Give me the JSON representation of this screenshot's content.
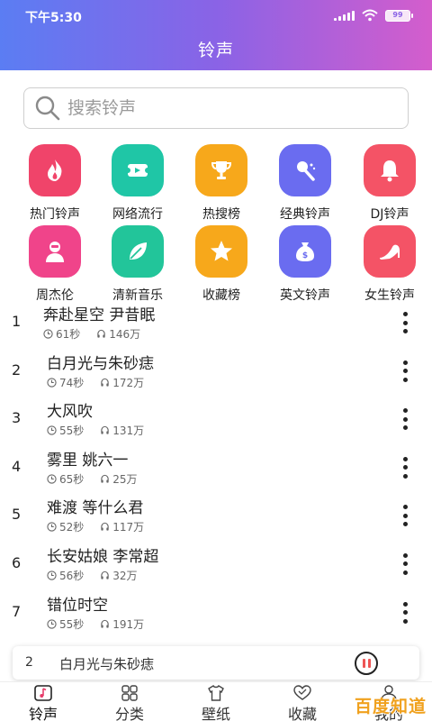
{
  "status_bar": {
    "time": "下午5:30",
    "battery": "99"
  },
  "header": {
    "title": "铃声"
  },
  "search": {
    "placeholder": "搜索铃声"
  },
  "categories": [
    {
      "label": "热门铃声",
      "icon": "flame-icon",
      "color": "#f0446a"
    },
    {
      "label": "网络流行",
      "icon": "ticket-icon",
      "color": "#1fc6a6"
    },
    {
      "label": "热搜榜",
      "icon": "trophy-icon",
      "color": "#f7a81b"
    },
    {
      "label": "经典铃声",
      "icon": "microphone-icon",
      "color": "#6a6cf0"
    },
    {
      "label": "DJ铃声",
      "icon": "bell-icon",
      "color": "#f45366"
    },
    {
      "label": "周杰伦",
      "icon": "singer-icon",
      "color": "#f0448a"
    },
    {
      "label": "清新音乐",
      "icon": "leaf-icon",
      "color": "#22c59a"
    },
    {
      "label": "收藏榜",
      "icon": "star-icon",
      "color": "#f7a81b"
    },
    {
      "label": "英文铃声",
      "icon": "money-bag-icon",
      "color": "#6a6cf0"
    },
    {
      "label": "女生铃声",
      "icon": "high-heel-icon",
      "color": "#f45366"
    }
  ],
  "songs": [
    {
      "rank": "1",
      "title": "奔赴星空 尹昔眠",
      "duration": "61秒",
      "plays": "146万"
    },
    {
      "rank": "2",
      "title": "白月光与朱砂痣",
      "duration": "74秒",
      "plays": "172万"
    },
    {
      "rank": "3",
      "title": "大风吹",
      "duration": "55秒",
      "plays": "131万"
    },
    {
      "rank": "4",
      "title": "雾里 姚六一",
      "duration": "65秒",
      "plays": "25万"
    },
    {
      "rank": "5",
      "title": "难渡 等什么君",
      "duration": "52秒",
      "plays": "117万"
    },
    {
      "rank": "6",
      "title": "长安姑娘 李常超",
      "duration": "56秒",
      "plays": "32万"
    },
    {
      "rank": "7",
      "title": "错位时空",
      "duration": "55秒",
      "plays": "191万"
    }
  ],
  "player": {
    "number": "2",
    "title": "白月光与朱砂痣"
  },
  "tabs": [
    {
      "label": "铃声",
      "icon": "music-note-icon",
      "active": true
    },
    {
      "label": "分类",
      "icon": "grid-icon"
    },
    {
      "label": "壁纸",
      "icon": "shirt-icon"
    },
    {
      "label": "收藏",
      "icon": "heart-icon"
    },
    {
      "label": "我的",
      "icon": "person-icon"
    }
  ],
  "watermark": "百度知道",
  "colors": {
    "header_start": "#5b7df3",
    "header_end": "#d45dcc"
  }
}
